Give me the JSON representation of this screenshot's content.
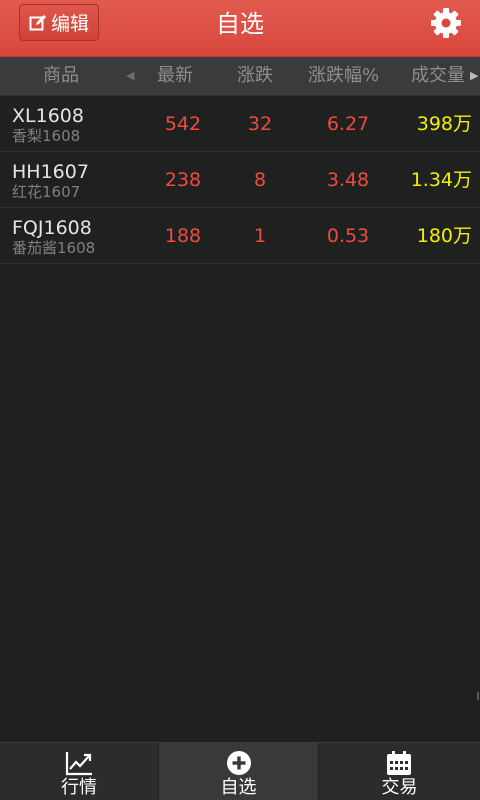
{
  "header": {
    "edit_label": "编辑",
    "title": "自选",
    "accent_color": "#d9473c"
  },
  "columns": {
    "goods": "商品",
    "latest": "最新",
    "change": "涨跌",
    "pct": "涨跌幅%",
    "volume": "成交量"
  },
  "rows": [
    {
      "symbol": "XL1608",
      "name": "香梨1608",
      "latest": "542",
      "change": "32",
      "pct": "6.27",
      "volume": "398万"
    },
    {
      "symbol": "HH1607",
      "name": "红花1607",
      "latest": "238",
      "change": "8",
      "pct": "3.48",
      "volume": "1.34万"
    },
    {
      "symbol": "FQJ1608",
      "name": "番茄酱1608",
      "latest": "188",
      "change": "1",
      "pct": "0.53",
      "volume": "180万"
    }
  ],
  "nav": {
    "market": "行情",
    "watchlist": "自选",
    "trade": "交易",
    "active": "watchlist"
  },
  "icons": {
    "edit": "edit-icon",
    "settings": "gear-icon",
    "market": "chart-icon",
    "watchlist": "plus-circle-icon",
    "trade": "calendar-icon"
  },
  "colors": {
    "up": "#f04a40",
    "volume": "#f4f000"
  }
}
